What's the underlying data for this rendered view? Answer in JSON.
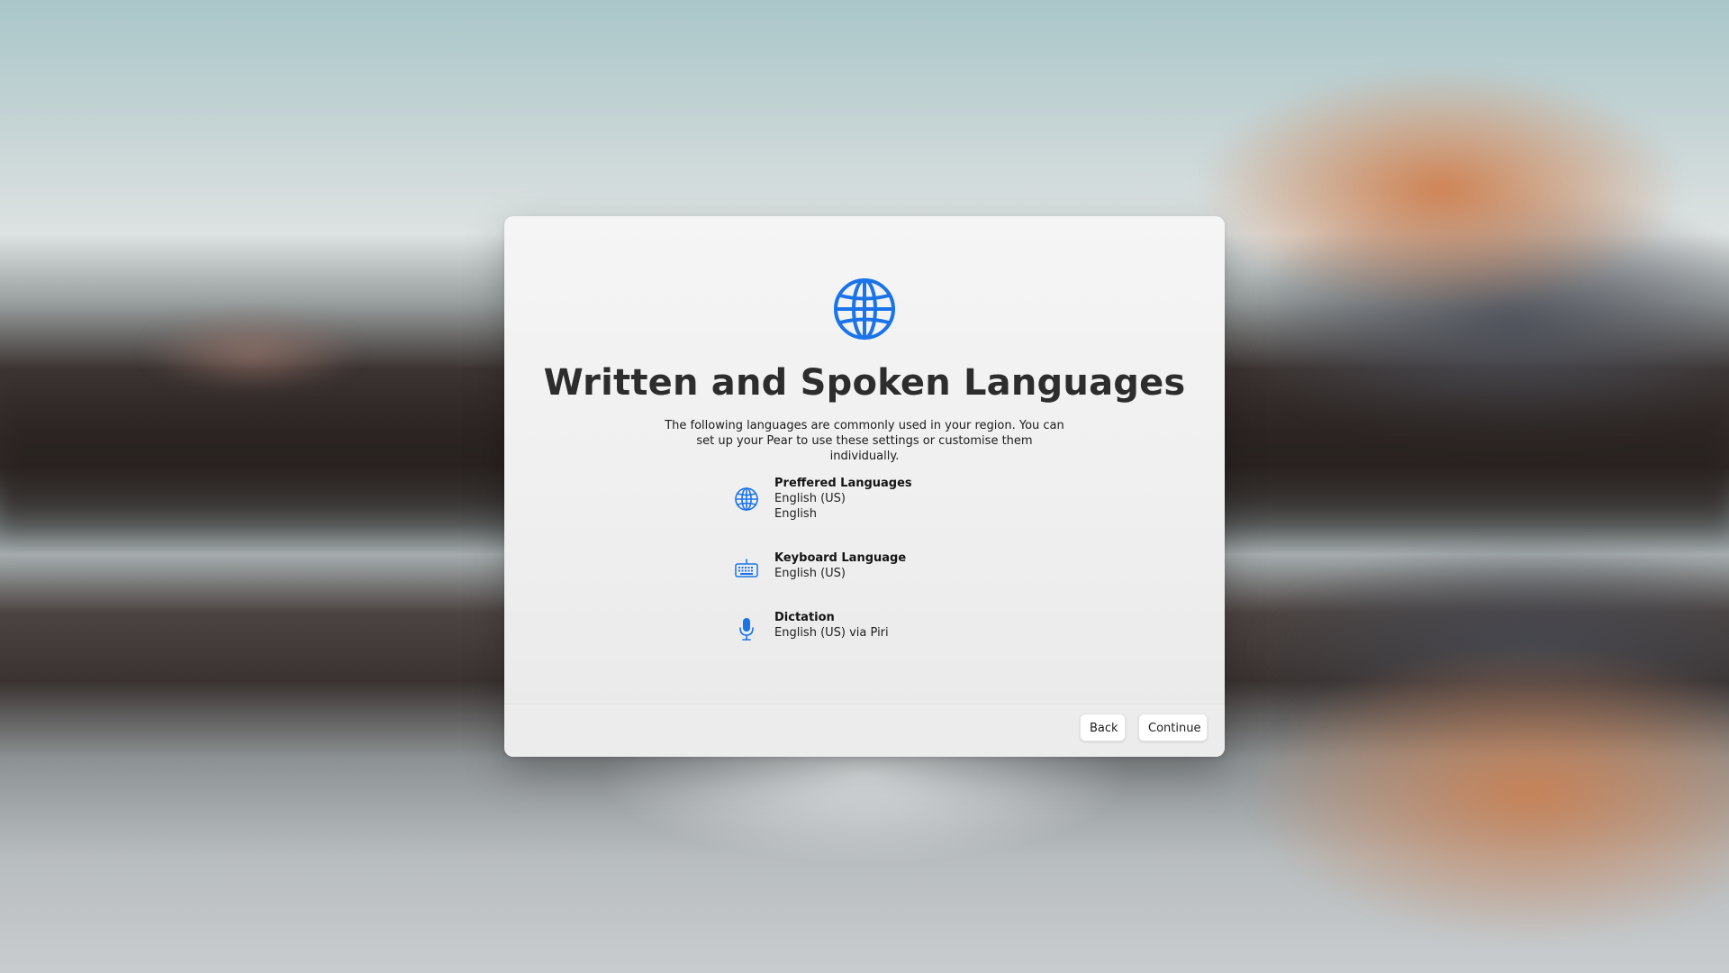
{
  "colors": {
    "accent": "#1a73e8",
    "title_text": "#2d2d2d",
    "body_text": "#1f1f1f",
    "dialog_bg": "#efefef",
    "button_bg": "#ffffff"
  },
  "dialog": {
    "hero_icon": "globe-icon",
    "title": "Written and Spoken Languages",
    "subtitle": "The following languages are commonly used in your region. You can set up your Pear to use these settings or customise them individually.",
    "items": [
      {
        "icon": "globe-icon",
        "title": "Preffered Languages",
        "lines": [
          "English (US)",
          "English"
        ]
      },
      {
        "icon": "keyboard-icon",
        "title": "Keyboard Language",
        "lines": [
          "English (US)"
        ]
      },
      {
        "icon": "microphone-icon",
        "title": "Dictation",
        "lines": [
          "English (US) via Piri"
        ]
      }
    ],
    "buttons": {
      "back": "Back",
      "continue": "Continue"
    }
  }
}
